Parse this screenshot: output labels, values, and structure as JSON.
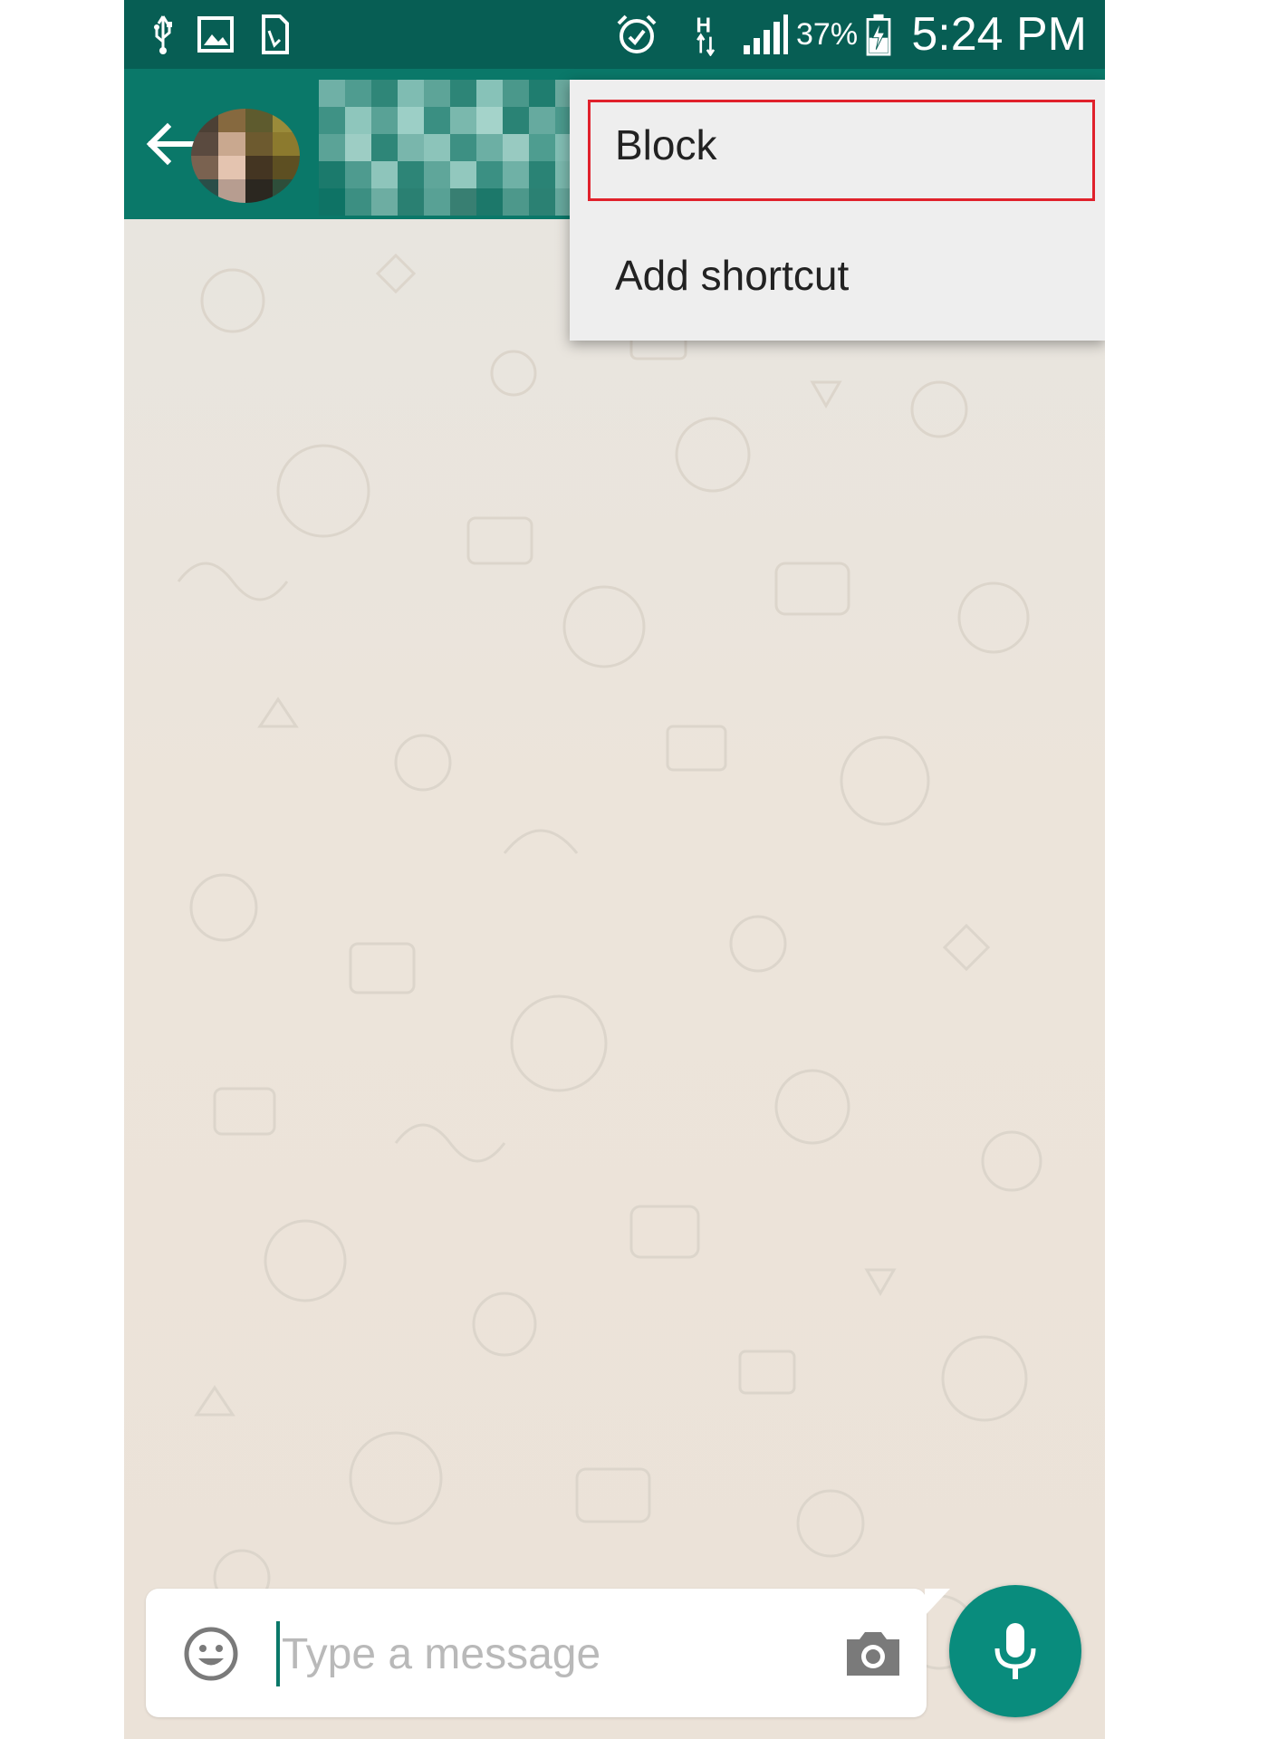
{
  "status_bar": {
    "icons": [
      "usb-icon",
      "image-icon",
      "sim-card-icon",
      "alarm-icon",
      "hspa-icon",
      "signal-icon",
      "battery-charging-icon"
    ],
    "battery_percent": "37%",
    "time": "5:24 PM"
  },
  "toolbar": {
    "back_icon": "arrow-left-icon",
    "contact_name": "",
    "avatar": "pixelated-avatar"
  },
  "menu": {
    "items": [
      {
        "label": "Block",
        "highlighted": true
      },
      {
        "label": "Add shortcut",
        "highlighted": false
      }
    ]
  },
  "composer": {
    "placeholder": "Type a message",
    "value": "",
    "emoji_icon": "smiley-icon",
    "camera_icon": "camera-icon",
    "mic_icon": "microphone-icon"
  },
  "colors": {
    "status_bar": "#075e54",
    "toolbar": "#0a7869",
    "accent": "#098c7d",
    "wallpaper": "#ece5dd",
    "highlight": "#e0212b"
  }
}
